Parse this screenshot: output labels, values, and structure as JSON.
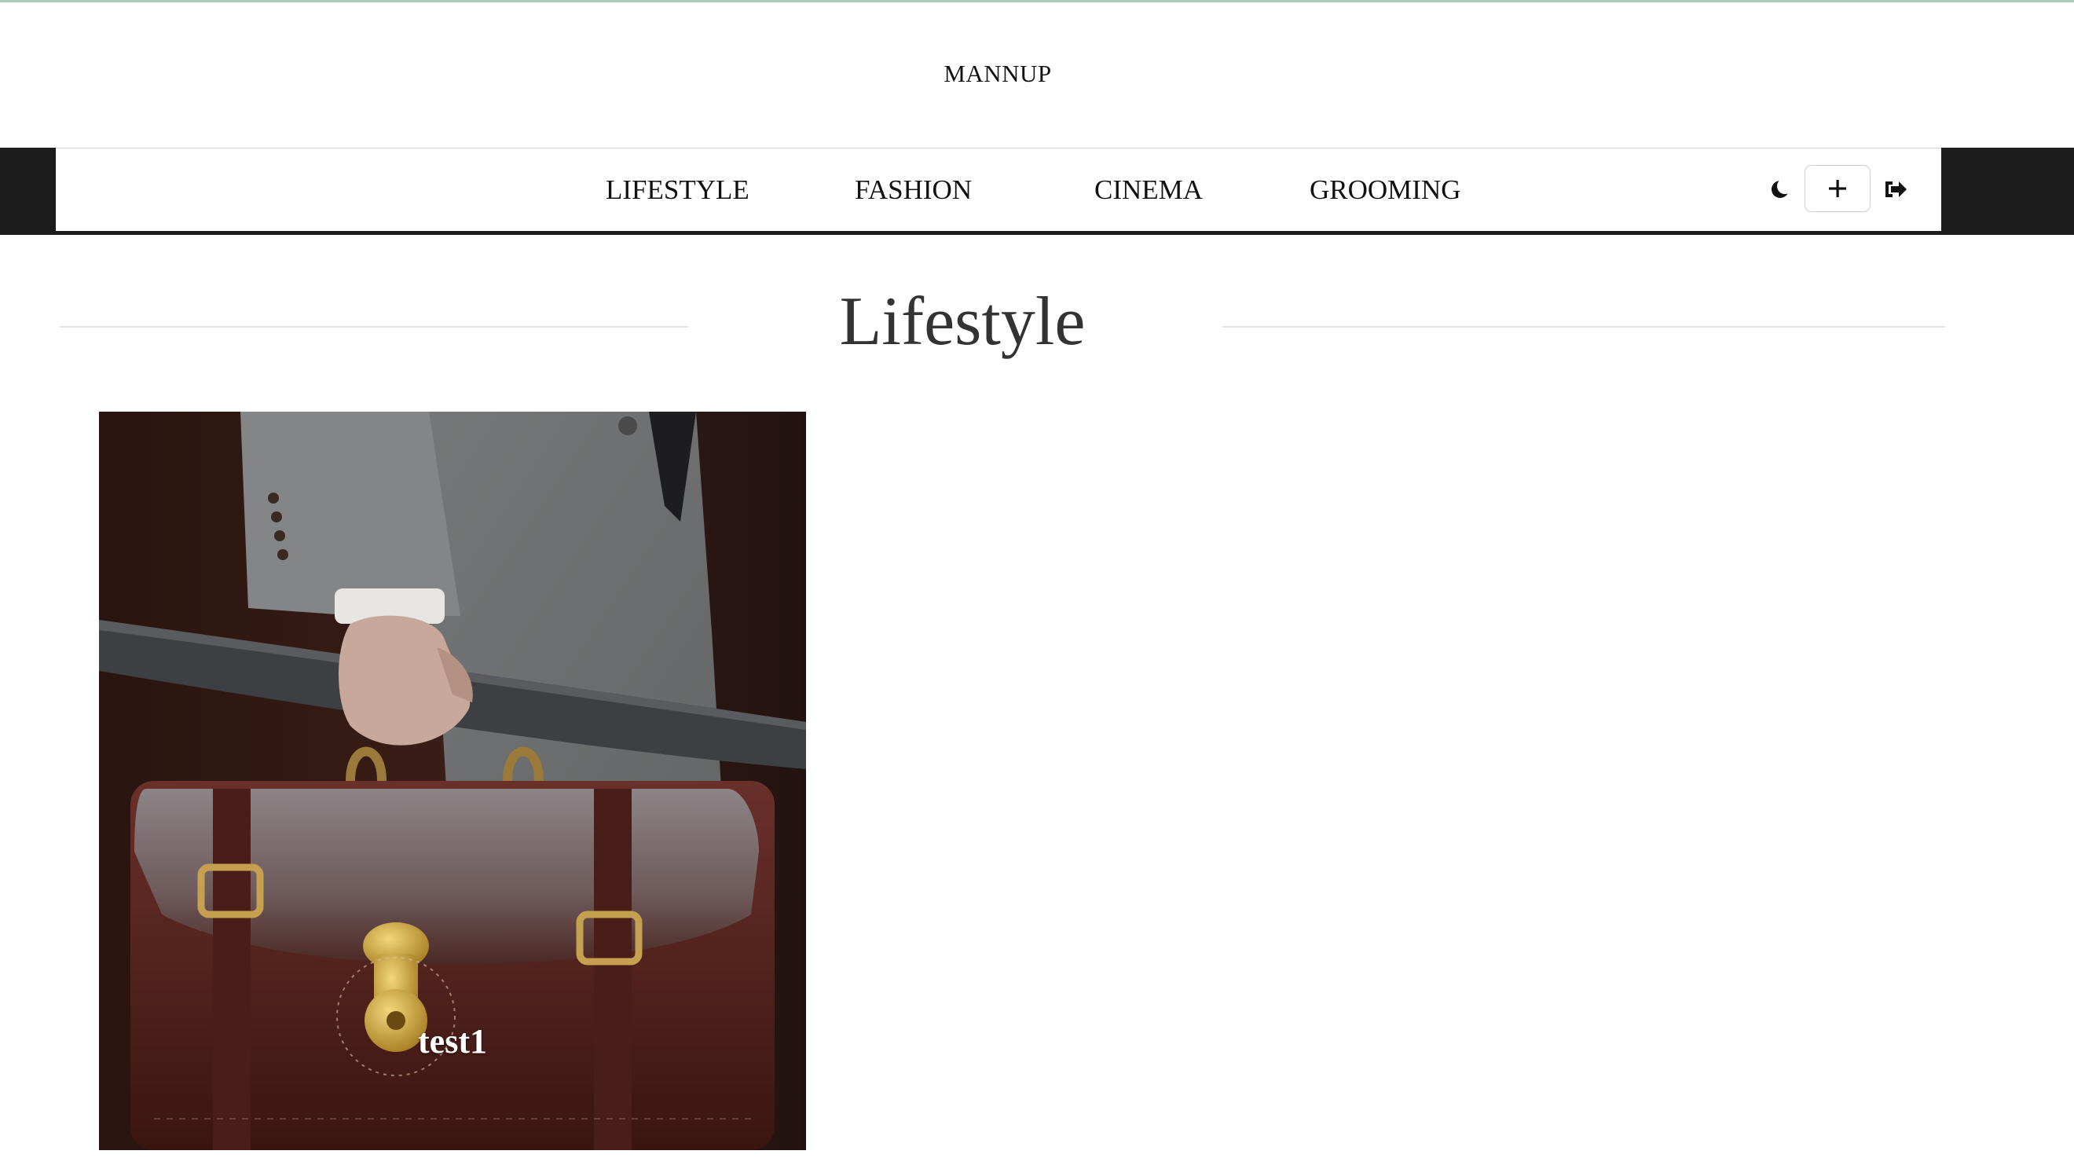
{
  "site": {
    "brand": "MANNUP"
  },
  "nav": {
    "items": [
      {
        "label": "LIFESTYLE"
      },
      {
        "label": "FASHION"
      },
      {
        "label": "CINEMA"
      },
      {
        "label": "GROOMING"
      }
    ],
    "tools": {
      "theme_icon": "moon-icon",
      "add_icon": "plus-icon",
      "logout_icon": "sign-out-icon"
    }
  },
  "section": {
    "title": "Lifestyle"
  },
  "posts": [
    {
      "title": "test1",
      "image": "man-with-leather-briefcase-and-umbrella"
    }
  ],
  "colors": {
    "nav_band": "#1c1c1c",
    "accent_top_line": "#a9cbb3",
    "title_text": "#333333"
  }
}
